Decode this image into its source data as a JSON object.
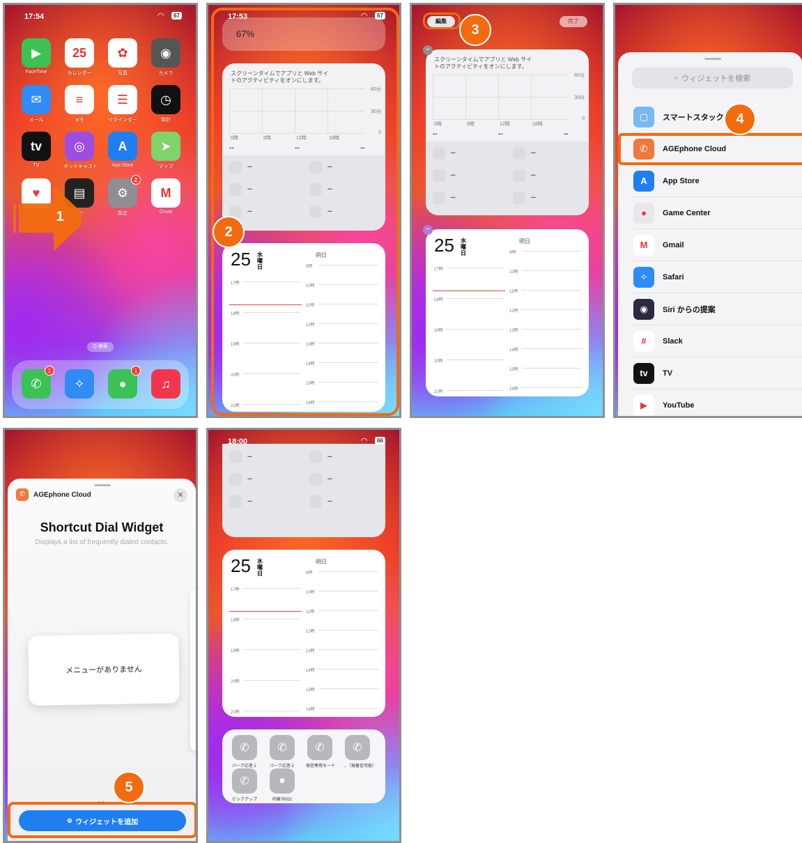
{
  "panel1": {
    "time": "17:54",
    "battery": "67",
    "search": "Q 検索",
    "apps": [
      {
        "label": "FaceTime",
        "icon": "video-icon",
        "color": "#3cc254",
        "glyph": "▶"
      },
      {
        "label": "カレンダー",
        "icon": "calendar-icon",
        "color": "#ffffff",
        "glyph": "25",
        "sub": "水"
      },
      {
        "label": "写真",
        "icon": "photos-icon",
        "color": "#ffffff",
        "glyph": "✿"
      },
      {
        "label": "カメラ",
        "icon": "camera-icon",
        "color": "#555555",
        "glyph": "◉"
      },
      {
        "label": "メール",
        "icon": "mail-icon",
        "color": "#2f8cf5",
        "glyph": "✉"
      },
      {
        "label": "メモ",
        "icon": "notes-icon",
        "color": "#ffffff",
        "glyph": "≡"
      },
      {
        "label": "リマインダー",
        "icon": "reminders-icon",
        "color": "#ffffff",
        "glyph": "☰"
      },
      {
        "label": "時計",
        "icon": "clock-icon",
        "color": "#111111",
        "glyph": "◷"
      },
      {
        "label": "TV",
        "icon": "tv-icon",
        "color": "#111111",
        "glyph": "tv"
      },
      {
        "label": "ポッドキャスト",
        "icon": "podcast-icon",
        "color": "#9b4ee0",
        "glyph": "◎"
      },
      {
        "label": "App Store",
        "icon": "appstore-icon",
        "color": "#1f7ff0",
        "glyph": "A"
      },
      {
        "label": "マップ",
        "icon": "maps-icon",
        "color": "#7fd36a",
        "glyph": "➤"
      },
      {
        "label": "",
        "icon": "health-icon",
        "color": "#ffffff",
        "glyph": "♥"
      },
      {
        "label": "ット",
        "icon": "wallet-icon",
        "color": "#222222",
        "glyph": "▤"
      },
      {
        "label": "設定",
        "icon": "settings-icon",
        "color": "#8e8e93",
        "glyph": "⚙",
        "badge": "2"
      },
      {
        "label": "Gmail",
        "icon": "gmail-icon",
        "color": "#ffffff",
        "glyph": "M"
      }
    ],
    "dock": [
      {
        "icon": "phone-icon",
        "color": "#3cc254",
        "glyph": "✆",
        "badge": "1"
      },
      {
        "icon": "safari-icon",
        "color": "#2f8cf5",
        "glyph": "✧"
      },
      {
        "icon": "messages-icon",
        "color": "#3cc254",
        "glyph": "●",
        "badge": "1"
      },
      {
        "icon": "music-icon",
        "color": "#f2364c",
        "glyph": "♫"
      }
    ],
    "step": "1"
  },
  "panel2": {
    "time": "17:53",
    "battery": "67",
    "battery_pct": "67%",
    "st_text": "スクリーンタイムでアプリと Web サイトのアクティビティをオンにします。",
    "y_ticks": [
      "60分",
      "30分",
      "0"
    ],
    "x_ticks": [
      "0時",
      "6時",
      "12時",
      "18時"
    ],
    "dash": "--",
    "day": "25",
    "weekday": "水曜日",
    "tomorrow": "明日",
    "left_hours": [
      "17時",
      "18時",
      "19時",
      "20時",
      "21時"
    ],
    "right_hours": [
      "9時",
      "10時",
      "11時",
      "12時",
      "13時",
      "14時",
      "15時",
      "16時"
    ],
    "step": "2"
  },
  "panel3": {
    "edit": "編集",
    "done": "完了",
    "step": "3"
  },
  "panel4": {
    "search_placeholder": "ウィジェットを検索",
    "step": "4",
    "items": [
      {
        "label": "スマートスタック",
        "icon": "smart-stack-icon",
        "color": "#7ab8f0",
        "glyph": "▢"
      },
      {
        "label": "AGEphone Cloud",
        "icon": "agephone-icon",
        "color": "#f0783a",
        "glyph": "✆"
      },
      {
        "label": "App Store",
        "icon": "appstore-icon",
        "color": "#1f7ff0",
        "glyph": "A"
      },
      {
        "label": "Game Center",
        "icon": "gamecenter-icon",
        "color": "#e8e8ec",
        "glyph": "●"
      },
      {
        "label": "Gmail",
        "icon": "gmail-icon",
        "color": "#ffffff",
        "glyph": "M"
      },
      {
        "label": "Safari",
        "icon": "safari-icon",
        "color": "#2f8cf5",
        "glyph": "✧"
      },
      {
        "label": "Siri からの提案",
        "icon": "siri-icon",
        "color": "#2a2a40",
        "glyph": "◉"
      },
      {
        "label": "Slack",
        "icon": "slack-icon",
        "color": "#ffffff",
        "glyph": "#"
      },
      {
        "label": "TV",
        "icon": "tv-icon",
        "color": "#111111",
        "glyph": "tv"
      },
      {
        "label": "YouTube",
        "icon": "youtube-icon",
        "color": "#ffffff",
        "glyph": "▶"
      }
    ]
  },
  "panel5": {
    "app_name": "AGEphone Cloud",
    "title": "Shortcut Dial Widget",
    "desc": "Displays a list of frequently dialed contacts.",
    "no_menu": "メニューがありません",
    "add_button": "ウィジェットを追加",
    "step": "5"
  },
  "panel6": {
    "time": "18:00",
    "battery": "66",
    "shortcuts": [
      {
        "label": "パーク応答１",
        "icon": "phone-icon"
      },
      {
        "label": "パーク応答２",
        "icon": "phone-icon"
      },
      {
        "label": "発信専用モード",
        "icon": "phone-icon"
      },
      {
        "label": "...（発着信可能）",
        "icon": "phone-icon"
      },
      {
        "label": "ピックアップ",
        "icon": "phone-icon"
      },
      {
        "label": "内線76021",
        "icon": "person-icon"
      }
    ]
  }
}
